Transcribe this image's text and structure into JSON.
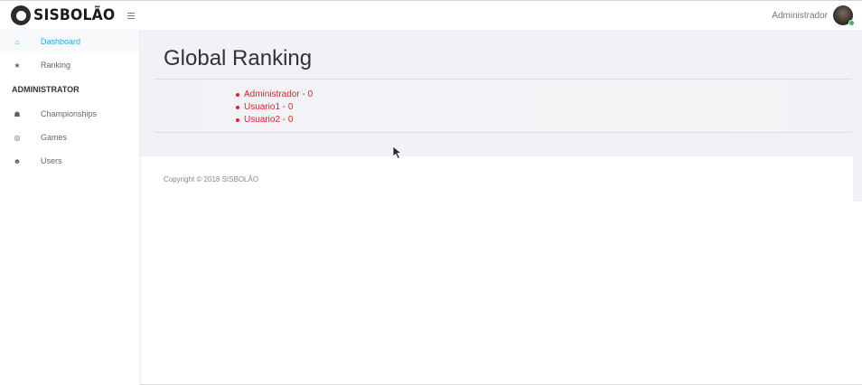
{
  "brand": {
    "logo_text": "SISBOLÃO"
  },
  "user": {
    "name": "Administrador"
  },
  "sidebar": {
    "items": [
      {
        "label": "Dashboard",
        "icon": "home-icon",
        "glyph": "⌂",
        "active": true
      },
      {
        "label": "Ranking",
        "icon": "star-icon",
        "glyph": "★",
        "active": false
      }
    ],
    "section_header": "ADMINISTRATOR",
    "admin_items": [
      {
        "label": "Championships",
        "icon": "trophy-icon",
        "glyph": "☗"
      },
      {
        "label": "Games",
        "icon": "soccer-ball-icon",
        "glyph": "◎"
      },
      {
        "label": "Users",
        "icon": "user-icon",
        "glyph": "☻"
      }
    ]
  },
  "main": {
    "title": "Global Ranking",
    "ranking": [
      {
        "text": "Administrador - 0"
      },
      {
        "text": "Usuario1 - 0"
      },
      {
        "text": "Usuario2 - 0"
      }
    ]
  },
  "footer": {
    "copyright": "Copyright © 2018 SISBOLÃO"
  },
  "colors": {
    "accent": "#28a6e0",
    "ranking_text": "#e0202a",
    "content_bg": "#f1f2f7"
  }
}
